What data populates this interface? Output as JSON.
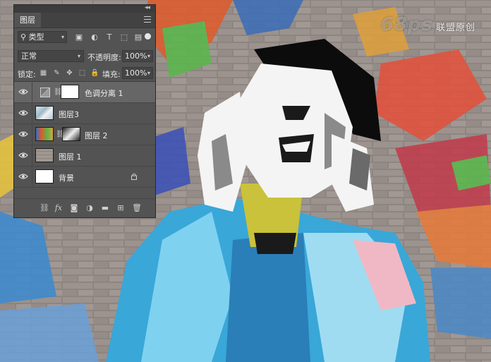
{
  "watermark": {
    "brand": "68ps",
    "text": "联盟原创"
  },
  "panel": {
    "tab_label": "图层",
    "collapse_glyph": "◂◂",
    "close_glyph": "✕",
    "filter": {
      "kind_label": "类型",
      "dropdown_glyph": "▾"
    },
    "blend": {
      "mode": "正常",
      "opacity_label": "不透明度:",
      "opacity_value": "100%"
    },
    "lock": {
      "label": "锁定:",
      "fill_label": "填充:",
      "fill_value": "100%"
    },
    "layers": [
      {
        "name": "色调分离 1",
        "visible": true,
        "selected": true,
        "type": "adjustment"
      },
      {
        "name": "图层3",
        "visible": true,
        "selected": false,
        "type": "pixel"
      },
      {
        "name": "图层 2",
        "visible": true,
        "selected": false,
        "type": "pixel-with-mask"
      },
      {
        "name": "图层 1",
        "visible": true,
        "selected": false,
        "type": "pixel"
      },
      {
        "name": "背景",
        "visible": true,
        "selected": false,
        "type": "background",
        "locked": true
      }
    ],
    "bottom_icons": [
      "link-layers-icon",
      "fx-icon",
      "add-mask-icon",
      "adjustment-layer-icon",
      "new-group-icon",
      "new-layer-icon",
      "trash-icon"
    ]
  },
  "colors": {
    "panel_bg": "#535353",
    "selected_row": "#666666",
    "accent_blue": "#39a7d8",
    "photo_black": "#0c0c0c"
  }
}
